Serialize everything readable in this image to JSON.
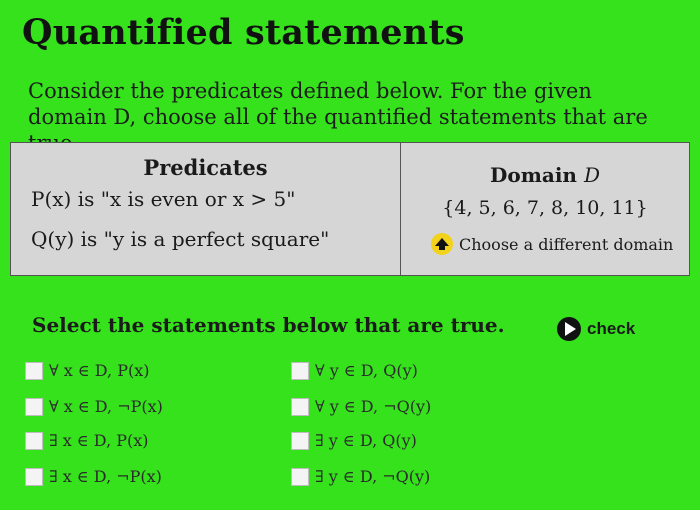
{
  "title": "Quantified statements",
  "intro": "Consider the predicates defined below. For the given domain D, choose all of the quantified statements that are true.",
  "table": {
    "predicates_header": "Predicates",
    "predicates": [
      "P(x) is \"x is even or x > 5\"",
      "Q(y) is \"y is a perfect square\""
    ],
    "domain_header": "Domain",
    "domain_var": "D",
    "domain_set": "{4, 5, 6, 7, 8, 10, 11}",
    "change_domain_label": "Choose a different domain"
  },
  "select_label": "Select the statements below that are true.",
  "check_label": "check",
  "statements_left": [
    "∀ x ∈ D, P(x)",
    "∀ x ∈ D, ¬P(x)",
    "∃ x ∈ D, P(x)",
    "∃ x ∈ D, ¬P(x)"
  ],
  "statements_right": [
    "∀ y ∈ D, Q(y)",
    "∀ y ∈ D, ¬Q(y)",
    "∃ y ∈ D, Q(y)",
    "∃ y ∈ D, ¬Q(y)"
  ]
}
